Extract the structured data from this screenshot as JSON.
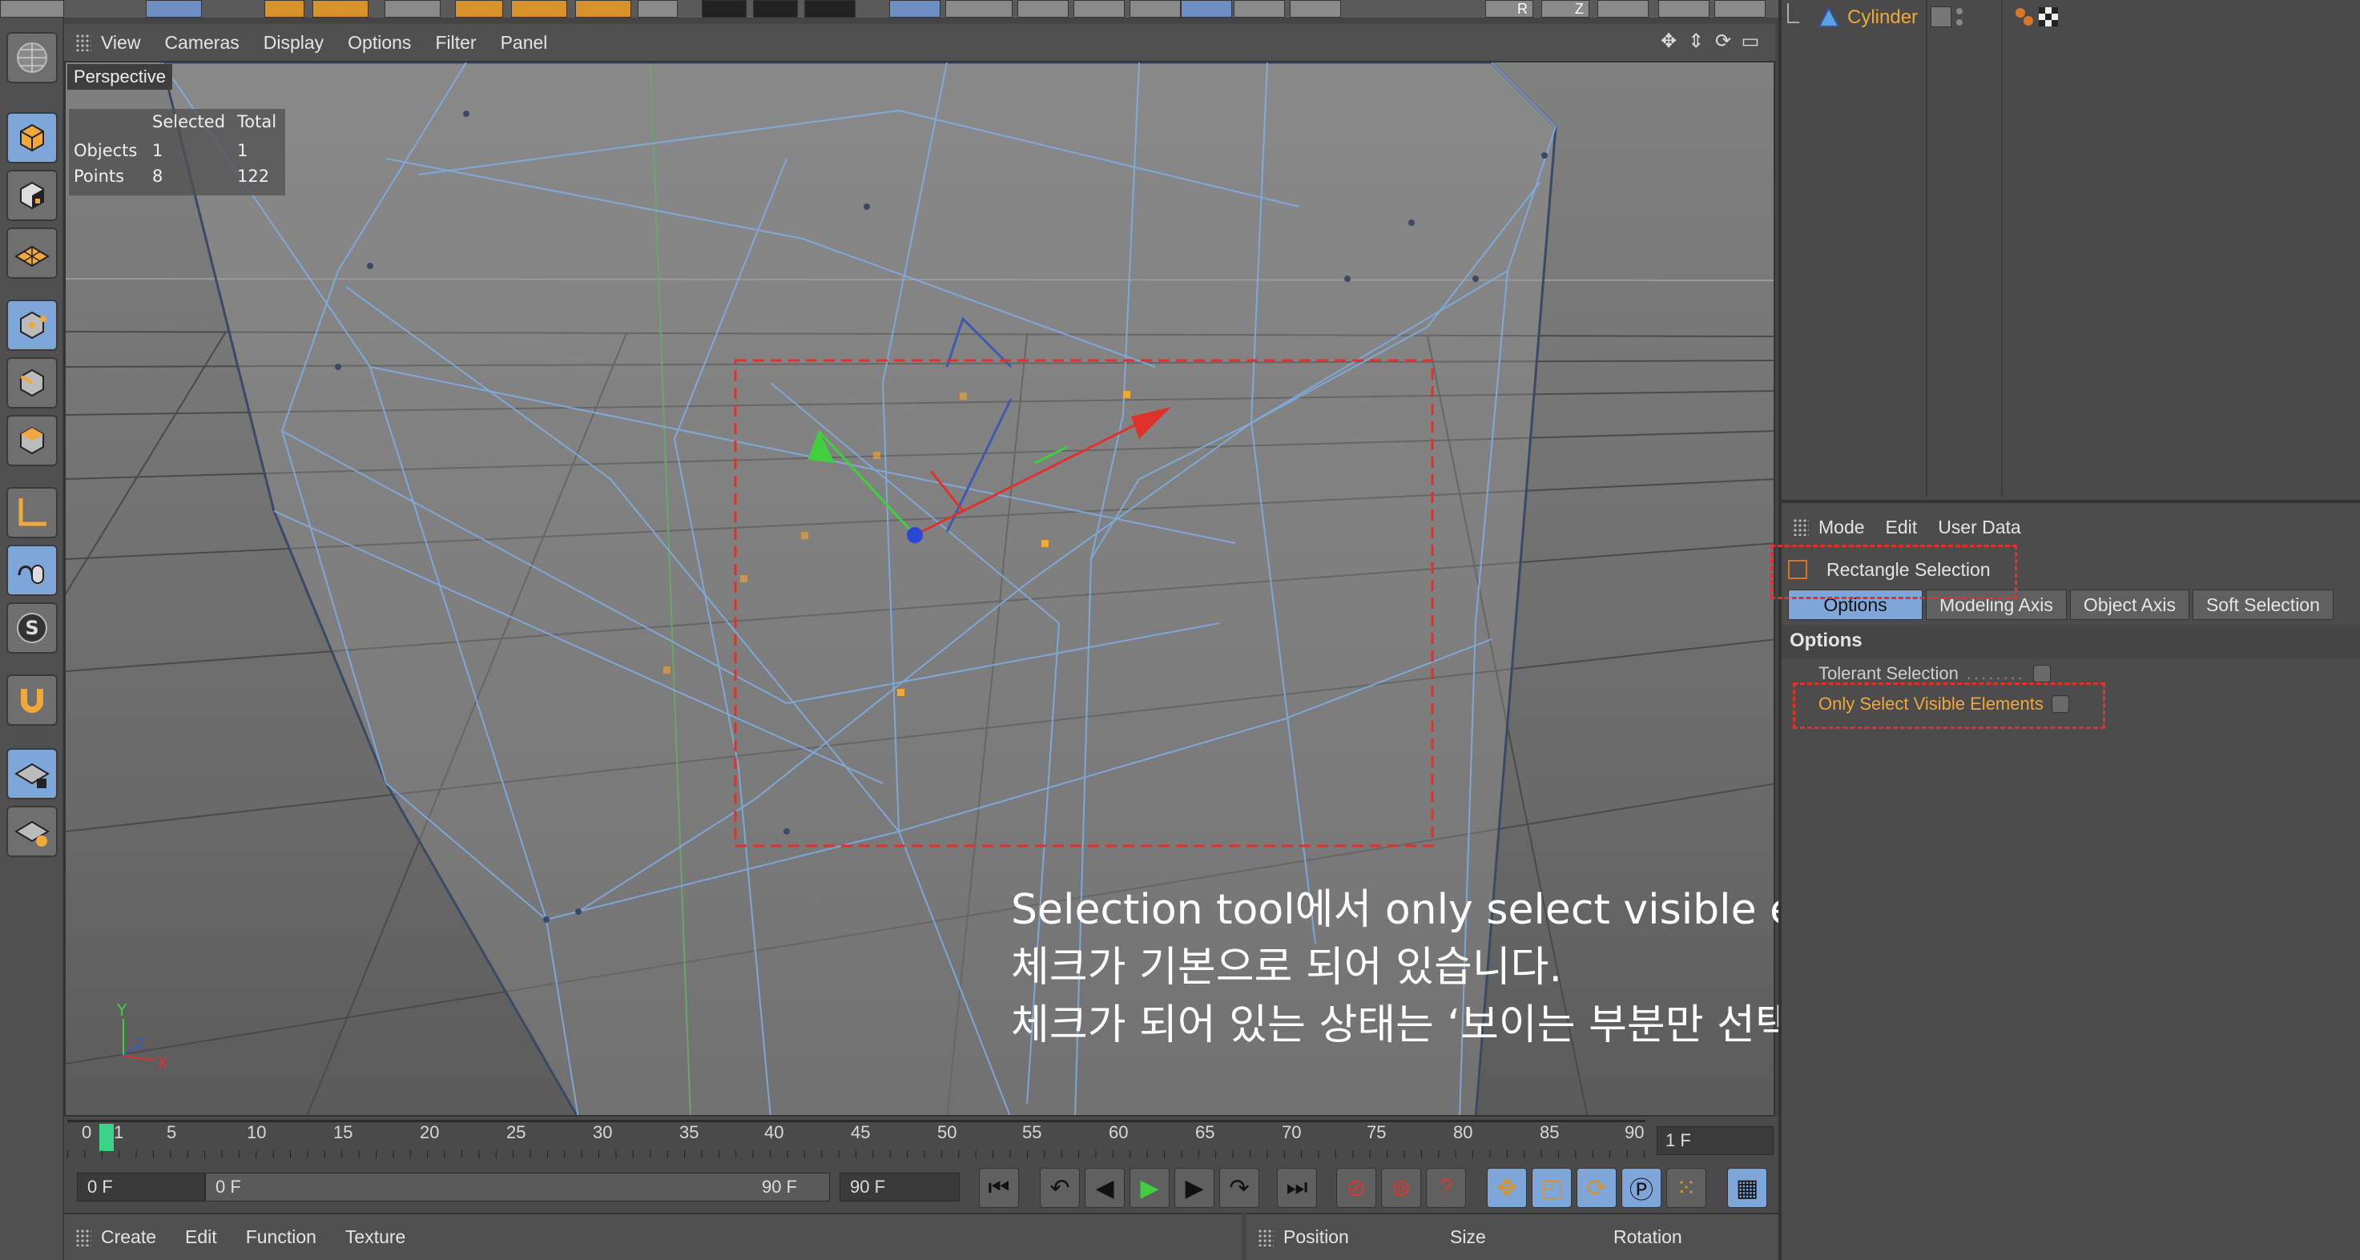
{
  "viewport_menu": {
    "items": [
      "View",
      "Cameras",
      "Display",
      "Options",
      "Filter",
      "Panel"
    ],
    "camera_label": "Perspective"
  },
  "stats": {
    "col_selected": "Selected",
    "col_total": "Total",
    "rows": [
      {
        "label": "Objects",
        "selected": "1",
        "total": "1"
      },
      {
        "label": "Points",
        "selected": "8",
        "total": "122"
      }
    ]
  },
  "axis_labels": {
    "y": "Y",
    "z": "Z",
    "x": "X"
  },
  "annotation": {
    "line1": "Selection tool에서 only select visible elements를 끄기.",
    "line2": "체크가 기본으로 되어 있습니다.",
    "line3": "체크가 되어 있는 상태는 ‘보이는 부분만 선택 하겠다’ 라는 뜻이에요~"
  },
  "timeline": {
    "ticks": [
      "0",
      "1",
      "5",
      "10",
      "15",
      "20",
      "25",
      "30",
      "35",
      "40",
      "45",
      "50",
      "55",
      "60",
      "65",
      "70",
      "75",
      "80",
      "85",
      "90"
    ],
    "current_frame": "1 F"
  },
  "playbar": {
    "start_field": "0 F",
    "range_start": "0 F",
    "range_end": "90 F",
    "end_field": "90 F"
  },
  "bottom_menu": {
    "items": [
      "Create",
      "Edit",
      "Function",
      "Texture"
    ]
  },
  "coord_panel": {
    "headers": [
      "Position",
      "Size",
      "Rotation"
    ]
  },
  "top_toolbar": {
    "labels": [
      "R",
      "Z"
    ]
  },
  "object_manager": {
    "object_name": "Cylinder"
  },
  "attributes": {
    "menu": [
      "Mode",
      "Edit",
      "User Data"
    ],
    "tool_name": "Rectangle Selection",
    "tabs": [
      "Options",
      "Modeling Axis",
      "Object Axis",
      "Soft Selection"
    ],
    "section": "Options",
    "options": [
      {
        "label": "Tolerant Selection",
        "checked": false
      },
      {
        "label": "Only Select Visible Elements",
        "checked": false,
        "highlight": true
      }
    ]
  },
  "colors": {
    "highlight_text": "#f0a83a",
    "annotation_box": "#e0312a",
    "active_tab": "#7fa6d9",
    "wireframe": "#7fb0e8"
  }
}
